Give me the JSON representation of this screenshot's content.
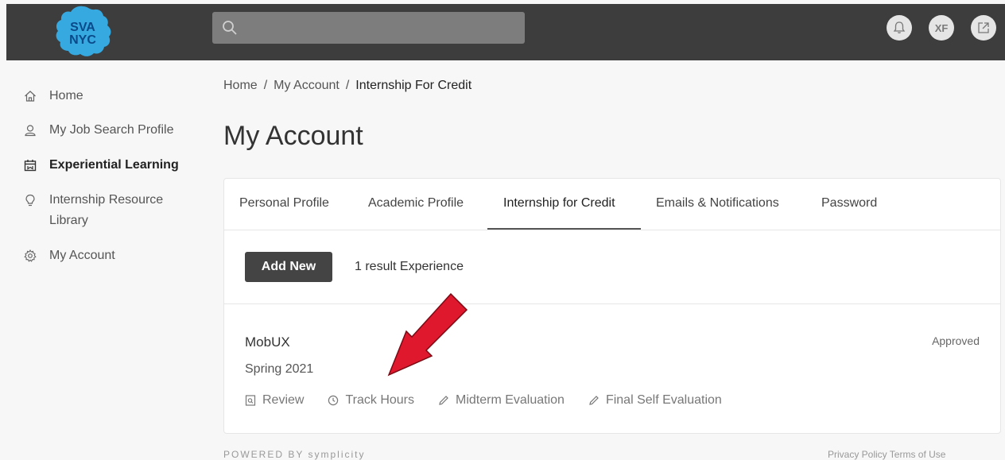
{
  "header": {
    "logo_text_line1": "SVA",
    "logo_text_line2": "NYC",
    "user_initials": "XF"
  },
  "sidebar": {
    "items": [
      {
        "label": "Home",
        "icon": "home-icon"
      },
      {
        "label": "My Job Search Profile",
        "icon": "user-icon"
      },
      {
        "label": "Experiential Learning",
        "icon": "calendar-icon",
        "active": true
      },
      {
        "label_line1": "Internship Resource",
        "label_line2": "Library",
        "icon": "lightbulb-icon"
      },
      {
        "label": "My Account",
        "icon": "gear-icon"
      }
    ]
  },
  "breadcrumb": {
    "items": [
      "Home",
      "My Account",
      "Internship For Credit"
    ],
    "separator": "/"
  },
  "page_title": "My Account",
  "tabs": [
    {
      "label": "Personal Profile"
    },
    {
      "label": "Academic Profile"
    },
    {
      "label": "Internship for Credit",
      "active": true
    },
    {
      "label": "Emails & Notifications"
    },
    {
      "label": "Password"
    }
  ],
  "toolbar": {
    "add_label": "Add New",
    "result_text": "1 result Experience"
  },
  "experience": {
    "name": "MobUX",
    "term": "Spring 2021",
    "status": "Approved",
    "actions": [
      {
        "label": "Review",
        "icon": "review-icon"
      },
      {
        "label": "Track Hours",
        "icon": "clock-icon"
      },
      {
        "label": "Midterm Evaluation",
        "icon": "pencil-icon"
      },
      {
        "label": "Final Self Evaluation",
        "icon": "pencil-icon"
      }
    ]
  },
  "footer": {
    "powered_by": "POWERED BY",
    "brand": "symplicity",
    "links": "Privacy Policy  Terms of Use"
  },
  "colors": {
    "topbar": "#3d3d3d",
    "logo_blue": "#35a9e0",
    "annotation_arrow": "#e0182d"
  }
}
